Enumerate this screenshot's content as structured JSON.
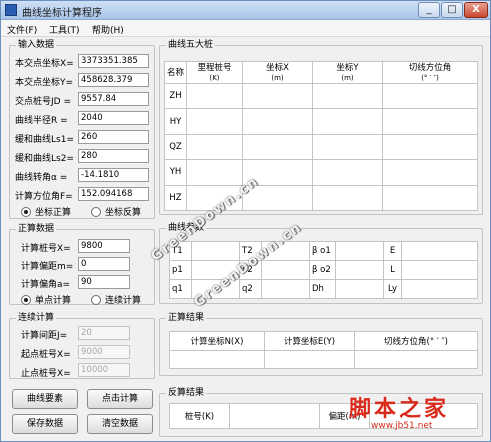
{
  "window": {
    "title": "曲线坐标计算程序",
    "min": "_",
    "max": "□",
    "close": "X"
  },
  "menu": [
    "文件(F)",
    "工具(T)",
    "帮助(H)"
  ],
  "input_group": {
    "title": "输入数据",
    "fields": [
      {
        "label": "本交点坐标X=",
        "value": "3373351.385"
      },
      {
        "label": "本交点坐标Y=",
        "value": "458628.379"
      },
      {
        "label": "交点桩号JD =",
        "value": "9557.84"
      },
      {
        "label": "曲线半径R  =",
        "value": "2040"
      },
      {
        "label": "缓和曲线Ls1=",
        "value": "260"
      },
      {
        "label": "缓和曲线Ls2=",
        "value": "280"
      },
      {
        "label": "曲线转角α  =",
        "value": "-14.1810"
      },
      {
        "label": "计算方位角F=",
        "value": "152.094168"
      }
    ],
    "radio_forward": "坐标正算",
    "radio_reverse": "坐标反算"
  },
  "forward_group": {
    "title": "正算数据",
    "fields": [
      {
        "label": "计算桩号X=",
        "value": "9800"
      },
      {
        "label": "计算偏距m=",
        "value": "0"
      },
      {
        "label": "计算偏角a=",
        "value": "90"
      }
    ],
    "radio_single": "单点计算",
    "radio_continuous": "连续计算"
  },
  "continuous_group": {
    "title": "连续计算",
    "fields": [
      {
        "label": "计算间距J=",
        "value": "20"
      },
      {
        "label": "起点桩号X=",
        "value": "9000"
      },
      {
        "label": "止点桩号X=",
        "value": "10000"
      }
    ]
  },
  "buttons": {
    "curve_elements": "曲线要素",
    "click_calc": "点击计算",
    "save_data": "保存数据",
    "clear_data": "清空数据"
  },
  "five_points": {
    "title": "曲线五大桩",
    "headers": [
      {
        "name": "名称",
        "unit": ""
      },
      {
        "name": "里程桩号",
        "unit": "(K)"
      },
      {
        "name": "坐标X",
        "unit": "(m)"
      },
      {
        "name": "坐标Y",
        "unit": "(m)"
      },
      {
        "name": "切线方位角",
        "unit": "(° ′ ″)"
      }
    ],
    "rows": [
      "ZH",
      "HY",
      "QZ",
      "YH",
      "HZ"
    ]
  },
  "curve_params": {
    "title": "曲线参数",
    "labels": [
      [
        "T1",
        "β o1",
        "E"
      ],
      [
        "p1",
        "p2",
        "β o2",
        "L"
      ],
      [
        "q1",
        "q2",
        "Dh",
        "Ly"
      ]
    ],
    "t2": "T2"
  },
  "forward_result": {
    "title": "正算结果",
    "headers": [
      "计算坐标N(X)",
      "计算坐标E(Y)",
      "切线方位角(° ′ ″)"
    ]
  },
  "reverse_result": {
    "title": "反算结果",
    "station": "桩号(K)",
    "offset": "偏距(m)"
  },
  "watermark": {
    "text1": "GreenDown.cn",
    "text2": "GreenDown.cn"
  },
  "brand": {
    "name": "脚本之家",
    "url": "www.jb51.net"
  }
}
